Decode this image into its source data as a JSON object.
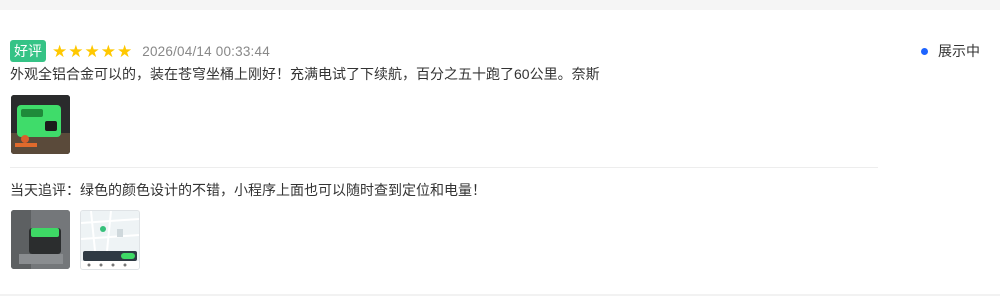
{
  "review": {
    "tag": "好评",
    "rating": 5,
    "date": "2026/04/14 00:33:44",
    "status": "展示中",
    "content": "外观全铝合金可以的，装在苍穹坐桶上刚好！充满电试了下续航，百分之五十跑了60公里。奈斯",
    "followup": "当天追评：绿色的颜色设计的不错，小程序上面也可以随时查到定位和电量！"
  },
  "colors": {
    "tag_bg": "#35c386",
    "star": "#ffc800",
    "status_dot": "#1e64ff"
  },
  "images": [
    {
      "name": "green-battery-photo"
    },
    {
      "name": "battery-on-floor-photo"
    },
    {
      "name": "map-app-screenshot"
    }
  ]
}
